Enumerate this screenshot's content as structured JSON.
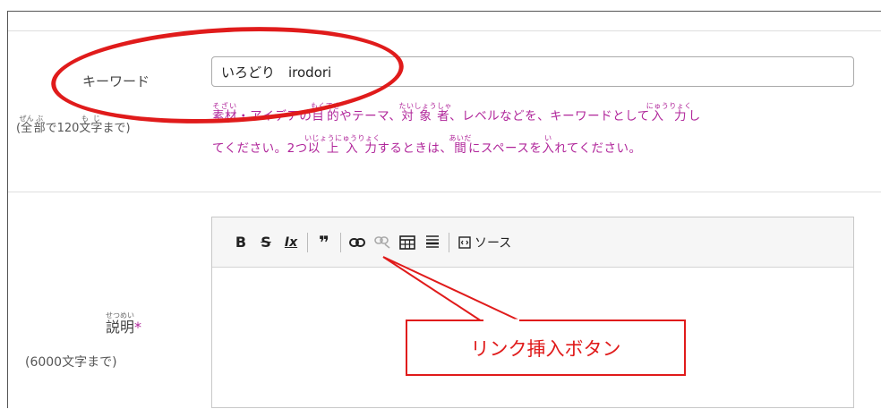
{
  "keyword": {
    "label": "キーワード",
    "hint": {
      "part1_base": "全",
      "part1_ruby": "ぜん",
      "part2_base": "部",
      "part2_ruby": "ぶ",
      "part3": "で120",
      "part4_base": "文字",
      "part4_ruby": "もじ",
      "part5": "まで"
    },
    "input_value": "いろどり　irodori",
    "help": {
      "r1": "そざい",
      "b1": "素材",
      "t1": "・アイデアの",
      "r2": "もくてき",
      "b2": "目的",
      "t2": "やテーマ、",
      "r3": "たいしょうしゃ",
      "b3": "対象者",
      "t3": "、レベルなどを、キーワードとして",
      "r4": "にゅうりょく",
      "b4": "入力",
      "t4": "し",
      "t5": "てください。2つ",
      "r5": "いじょうにゅうりょく",
      "b5": "以上入力",
      "t6": "するときは、",
      "r6": "あいだ",
      "b6": "間",
      "t7": "にスペースを",
      "r7": "い",
      "b7": "入",
      "t8": "れてください。"
    }
  },
  "description": {
    "label_base": "説明",
    "label_ruby": "せつめい",
    "required_mark": "*",
    "hint": "(6000文字まで)"
  },
  "editor": {
    "toolbar": {
      "bold": "B",
      "strike": "S",
      "clear_format": "Ix",
      "blockquote": "❞",
      "link": "🔗",
      "unlink": "⛓",
      "table": "⊞",
      "hr": "☰",
      "source_label": "ソース"
    }
  },
  "annotation": {
    "callout_text": "リンク挿入ボタン",
    "color": "#e01b1b"
  }
}
